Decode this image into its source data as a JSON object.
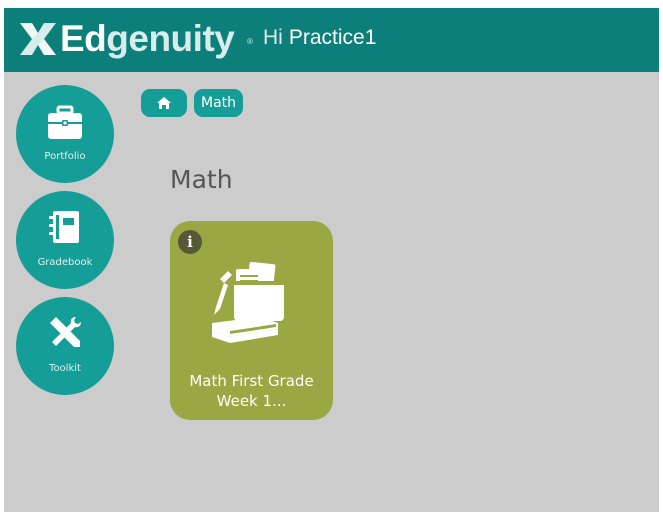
{
  "header": {
    "logo_prefix": "Ed",
    "logo_suffix": "genuity",
    "logo_reg": "®",
    "greeting_hi": "Hi",
    "user_name": "Practice1"
  },
  "sidebar": {
    "items": [
      {
        "label": "Portfolio",
        "icon": "briefcase-icon"
      },
      {
        "label": "Gradebook",
        "icon": "notebook-icon"
      },
      {
        "label": "Toolkit",
        "icon": "tools-icon"
      }
    ]
  },
  "breadcrumb": {
    "home_icon": "home-icon",
    "current": "Math"
  },
  "page": {
    "title": "Math"
  },
  "courses": [
    {
      "name": "Math First Grade Week 1...",
      "info": "i",
      "icon": "books-and-papers-icon",
      "color": "#99a842"
    }
  ],
  "colors": {
    "header": "#0d7f7a",
    "accent": "#159d97",
    "background": "#cccccc",
    "tile": "#99a842"
  }
}
